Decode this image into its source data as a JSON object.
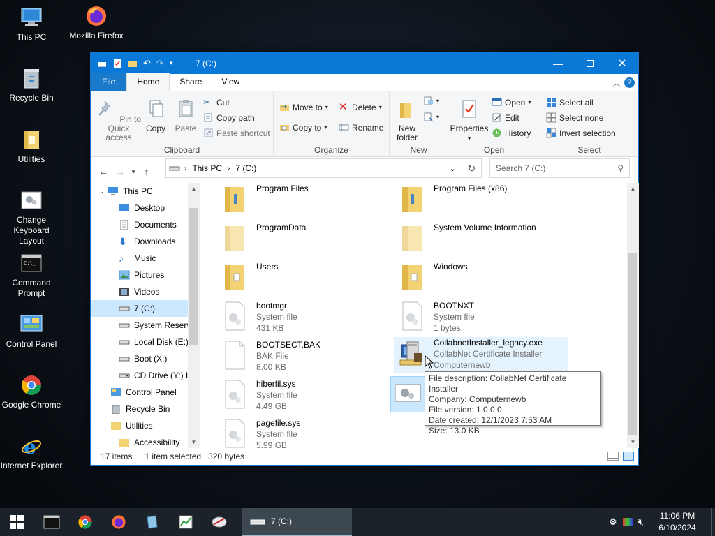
{
  "desktop": {
    "icons": [
      {
        "label": "This PC"
      },
      {
        "label": "Mozilla Firefox"
      },
      {
        "label": "Recycle Bin"
      },
      {
        "label": "Utilities"
      },
      {
        "label": "Change Keyboard Layout"
      },
      {
        "label": "Command Prompt"
      },
      {
        "label": "Control Panel"
      },
      {
        "label": "Google Chrome"
      },
      {
        "label": "Internet Explorer"
      }
    ]
  },
  "window": {
    "title": "7 (C:)",
    "tabs": {
      "file": "File",
      "home": "Home",
      "share": "Share",
      "view": "View"
    },
    "ribbon": {
      "clipboard": {
        "label": "Clipboard",
        "pin": "Pin to Quick access",
        "copy": "Copy",
        "paste": "Paste",
        "cut": "Cut",
        "copy_path": "Copy path",
        "paste_shortcut": "Paste shortcut"
      },
      "organize": {
        "label": "Organize",
        "move_to": "Move to",
        "copy_to": "Copy to",
        "delete": "Delete",
        "rename": "Rename"
      },
      "new": {
        "label": "New",
        "new_folder": "New folder"
      },
      "open": {
        "label": "Open",
        "properties": "Properties",
        "open": "Open",
        "edit": "Edit",
        "history": "History"
      },
      "select": {
        "label": "Select",
        "select_all": "Select all",
        "select_none": "Select none",
        "invert": "Invert selection"
      }
    },
    "address": {
      "root": "This PC",
      "current": "7 (C:)",
      "search_placeholder": "Search 7 (C:)"
    },
    "nav": [
      {
        "label": "This PC"
      },
      {
        "label": "Desktop"
      },
      {
        "label": "Documents"
      },
      {
        "label": "Downloads"
      },
      {
        "label": "Music"
      },
      {
        "label": "Pictures"
      },
      {
        "label": "Videos"
      },
      {
        "label": "7 (C:)"
      },
      {
        "label": "System Reserve"
      },
      {
        "label": "Local Disk (E:)"
      },
      {
        "label": "Boot (X:)"
      },
      {
        "label": "CD Drive (Y:) H"
      },
      {
        "label": "Control Panel"
      },
      {
        "label": "Recycle Bin"
      },
      {
        "label": "Utilities"
      },
      {
        "label": "Accessibility"
      }
    ],
    "files": [
      {
        "name": "Program Files",
        "type": "",
        "size": ""
      },
      {
        "name": "Program Files (x86)",
        "type": "",
        "size": ""
      },
      {
        "name": "ProgramData",
        "type": "",
        "size": ""
      },
      {
        "name": "System Volume Information",
        "type": "",
        "size": ""
      },
      {
        "name": "Users",
        "type": "",
        "size": ""
      },
      {
        "name": "Windows",
        "type": "",
        "size": ""
      },
      {
        "name": "bootmgr",
        "type": "System file",
        "size": "431 KB"
      },
      {
        "name": "BOOTNXT",
        "type": "System file",
        "size": "1 bytes"
      },
      {
        "name": "BOOTSECT.BAK",
        "type": "BAK File",
        "size": "8.00 KB"
      },
      {
        "name": "CollabnetInstaller_legacy.exe",
        "type": "CollabNet Certificate Installer",
        "size": "Computernewb"
      },
      {
        "name": "hiberfil.sys",
        "type": "System file",
        "size": "4.49 GB"
      },
      {
        "name": "pagefile.sys",
        "type": "System file",
        "size": "5.99 GB"
      }
    ],
    "status": {
      "count": "17 items",
      "selected": "1 item selected",
      "size": "320 bytes"
    },
    "tooltip": {
      "description": "File description: CollabNet Certificate Installer",
      "company": "Company: Computernewb",
      "version": "File version: 1.0.0.0",
      "created": "Date created: 12/1/2023 7:53 AM",
      "size": "Size: 13.0 KB"
    }
  },
  "taskbar": {
    "active_window": "7 (C:)",
    "time": "11:06 PM",
    "date": "6/10/2024"
  },
  "colors": {
    "accent": "#0a78d7",
    "selection": "#cce8ff",
    "folder": "#f3d274"
  }
}
